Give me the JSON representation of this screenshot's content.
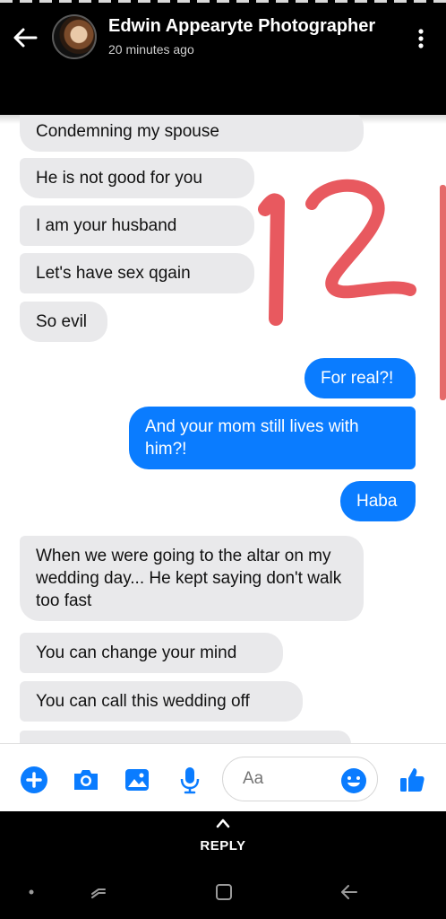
{
  "header": {
    "contact_name": "Edwin Appearyte Photographer",
    "status": "20 minutes ago"
  },
  "messages": [
    {
      "side": "in",
      "text": "Condemning my spouse"
    },
    {
      "side": "in",
      "text": "He is not good for you"
    },
    {
      "side": "in",
      "text": "I am your husband"
    },
    {
      "side": "in",
      "text": "Let's have sex qgain"
    },
    {
      "side": "in",
      "text": "So evil"
    },
    {
      "side": "out",
      "text": "For real?!"
    },
    {
      "side": "out",
      "text": "And your mom still lives with him?!"
    },
    {
      "side": "out",
      "text": "Haba"
    },
    {
      "side": "in",
      "text": "When we were going to the altar on my wedding day... He kept saying don't walk too fast"
    },
    {
      "side": "in",
      "text": "You can change your mind"
    },
    {
      "side": "in",
      "text": "You can call this wedding off"
    }
  ],
  "annotation": {
    "handwritten_number": "12",
    "color": "#e8595f"
  },
  "composer": {
    "placeholder": "Aa",
    "icons": [
      "plus-icon",
      "camera-icon",
      "image-icon",
      "microphone-icon",
      "emoji-icon",
      "thumbs-up-icon"
    ]
  },
  "reply_bar": {
    "label": "REPLY"
  },
  "colors": {
    "outgoing_bubble": "#0a7cff",
    "incoming_bubble": "#e9e9eb",
    "accent": "#0a7cff"
  }
}
